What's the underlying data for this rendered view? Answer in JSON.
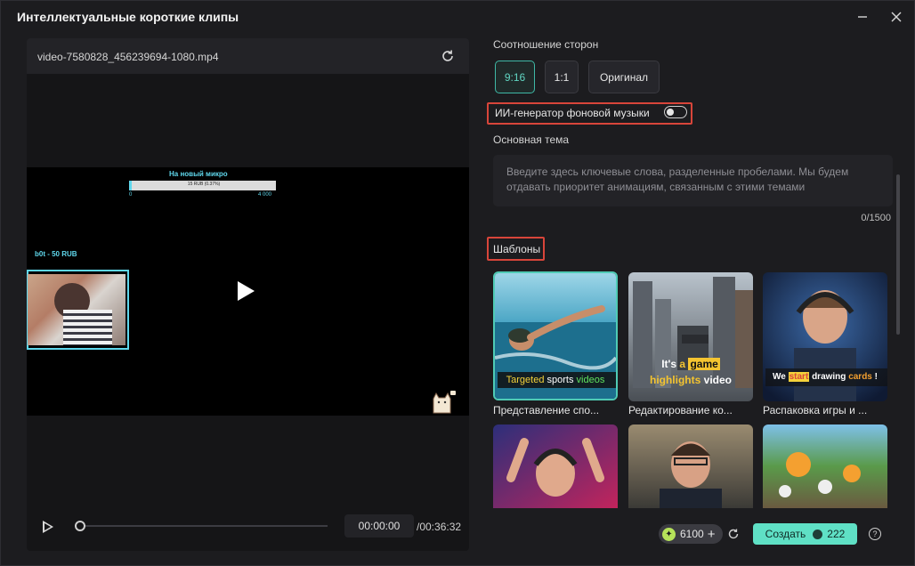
{
  "window": {
    "title": "Интеллектуальные короткие клипы"
  },
  "preview": {
    "filename": "video-7580828_456239694-1080.mp4",
    "video_overlay": {
      "donation_title": "На новый микро",
      "donation_progress": "15 RUB (0.37%)",
      "donation_min": "0",
      "donation_max": "4 000",
      "donor_label": "b0t - 50 RUB"
    },
    "controls": {
      "current_time": "00:00:00",
      "total_time": "/00:36:32",
      "progress": 0
    }
  },
  "aspect": {
    "label": "Соотношение сторон",
    "options": [
      "9:16",
      "1:1",
      "Оригинал"
    ],
    "selected": "9:16"
  },
  "ai_music": {
    "label": "ИИ-генератор фоновой музыки",
    "enabled": false
  },
  "theme": {
    "label": "Основная тема",
    "placeholder": "Введите здесь ключевые слова, разделенные пробелами. Мы будем отдавать приоритет анимациям, связанным с этими темами",
    "counter": "0/1500"
  },
  "templates": {
    "label": "Шаблоны",
    "items": [
      {
        "caption": "Представление спо...",
        "overlay": [
          "Targeted",
          "sports",
          "videos"
        ]
      },
      {
        "caption": "Редактирование ко...",
        "overlay": [
          "It's",
          "a",
          "game",
          "highlights",
          "video"
        ]
      },
      {
        "caption": "Распаковка игры и ...",
        "overlay": [
          "We",
          "start",
          "drawing",
          "cards",
          "!"
        ]
      }
    ]
  },
  "footer": {
    "credits": "6100",
    "create_label": "Создать",
    "create_cost": "222",
    "help": "?"
  },
  "colors": {
    "accent": "#5fe0c5",
    "highlight": "#d8453a",
    "overlay_cyan": "#5fd7ec"
  }
}
